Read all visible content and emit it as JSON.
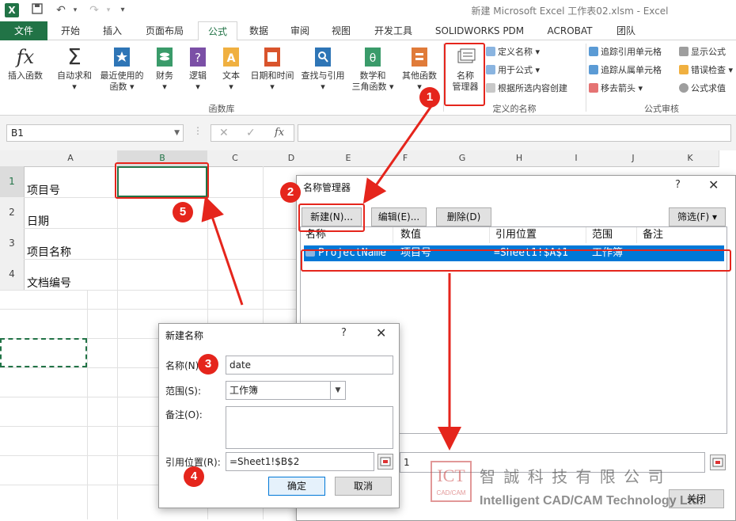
{
  "window": {
    "title": "新建 Microsoft Excel 工作表02.xlsm - Excel",
    "quick_access": {
      "dropdown": "▾"
    }
  },
  "tabs": [
    "文件",
    "开始",
    "插入",
    "页面布局",
    "公式",
    "数据",
    "审阅",
    "视图",
    "开发工具",
    "SOLIDWORKS PDM",
    "ACROBAT",
    "团队"
  ],
  "active_tab": "公式",
  "ribbon": {
    "function_library": {
      "label": "函数库",
      "buttons": [
        {
          "l1": "插入函数",
          "l2": ""
        },
        {
          "l1": "自动求和",
          "l2": "▾"
        },
        {
          "l1": "最近使用的",
          "l2": "函数 ▾"
        },
        {
          "l1": "财务",
          "l2": "▾"
        },
        {
          "l1": "逻辑",
          "l2": "▾"
        },
        {
          "l1": "文本",
          "l2": "▾"
        },
        {
          "l1": "日期和时间",
          "l2": "▾"
        },
        {
          "l1": "查找与引用",
          "l2": "▾"
        },
        {
          "l1": "数学和",
          "l2": "三角函数 ▾"
        },
        {
          "l1": "其他函数",
          "l2": "▾"
        }
      ]
    },
    "defined_names": {
      "label": "定义的名称",
      "name_manager_l1": "名称",
      "name_manager_l2": "管理器",
      "define_name": "定义名称 ▾",
      "use_in_formula": "用于公式 ▾",
      "create_from_selection": "根据所选内容创建"
    },
    "formula_auditing": {
      "label": "公式审核",
      "trace_precedents": "追踪引用单元格",
      "trace_dependents": "追踪从属单元格",
      "remove_arrows": "移去箭头 ▾",
      "show_formulas": "显示公式",
      "error_checking": "错误检查 ▾",
      "evaluate_formula": "公式求值"
    }
  },
  "formula_bar": {
    "name_box": "B1",
    "cancel": "✕",
    "enter": "✓",
    "fx": "fx",
    "content": ""
  },
  "grid": {
    "columns": [
      "A",
      "B",
      "C",
      "D",
      "E",
      "F",
      "G",
      "H",
      "I",
      "J",
      "K"
    ],
    "rows": [
      "1",
      "2",
      "3",
      "4"
    ],
    "a_values": [
      "项目号",
      "日期",
      "项目名称",
      "文档编号"
    ]
  },
  "name_manager": {
    "title": "名称管理器",
    "help": "?",
    "close_x": "✕",
    "new_btn": "新建(N)...",
    "edit_btn": "编辑(E)...",
    "delete_btn": "删除(D)",
    "filter_btn": "筛选(F) ▾",
    "headers": [
      "名称",
      "数值",
      "引用位置",
      "范围",
      "备注"
    ],
    "row": {
      "name": "ProjectName",
      "value": "项目号",
      "refers_to": "=Sheet1!$A$1",
      "scope": "工作簿",
      "comment": ""
    },
    "refers_to_field": "1",
    "close_btn": "关闭"
  },
  "new_name": {
    "title": "新建名称",
    "help": "?",
    "close_x": "✕",
    "name_label": "名称(N):",
    "name_value": "date",
    "scope_label": "范围(S):",
    "scope_value": "工作簿",
    "comment_label": "备注(O):",
    "comment_value": "",
    "refers_label": "引用位置(R):",
    "refers_value": "=Sheet1!$B$2",
    "ok": "确定",
    "cancel": "取消"
  },
  "markers": [
    "1",
    "2",
    "3",
    "4",
    "5"
  ],
  "watermark": {
    "logo": "ICT",
    "logo_sub": "CAD/CAM",
    "cn": "智 誠 科 技 有 限 公 司",
    "en": "Intelligent CAD/CAM Technology Ltd."
  },
  "colors": {
    "excel_green": "#217346",
    "annotation_red": "#e5251c",
    "selection_blue": "#0078d7"
  }
}
